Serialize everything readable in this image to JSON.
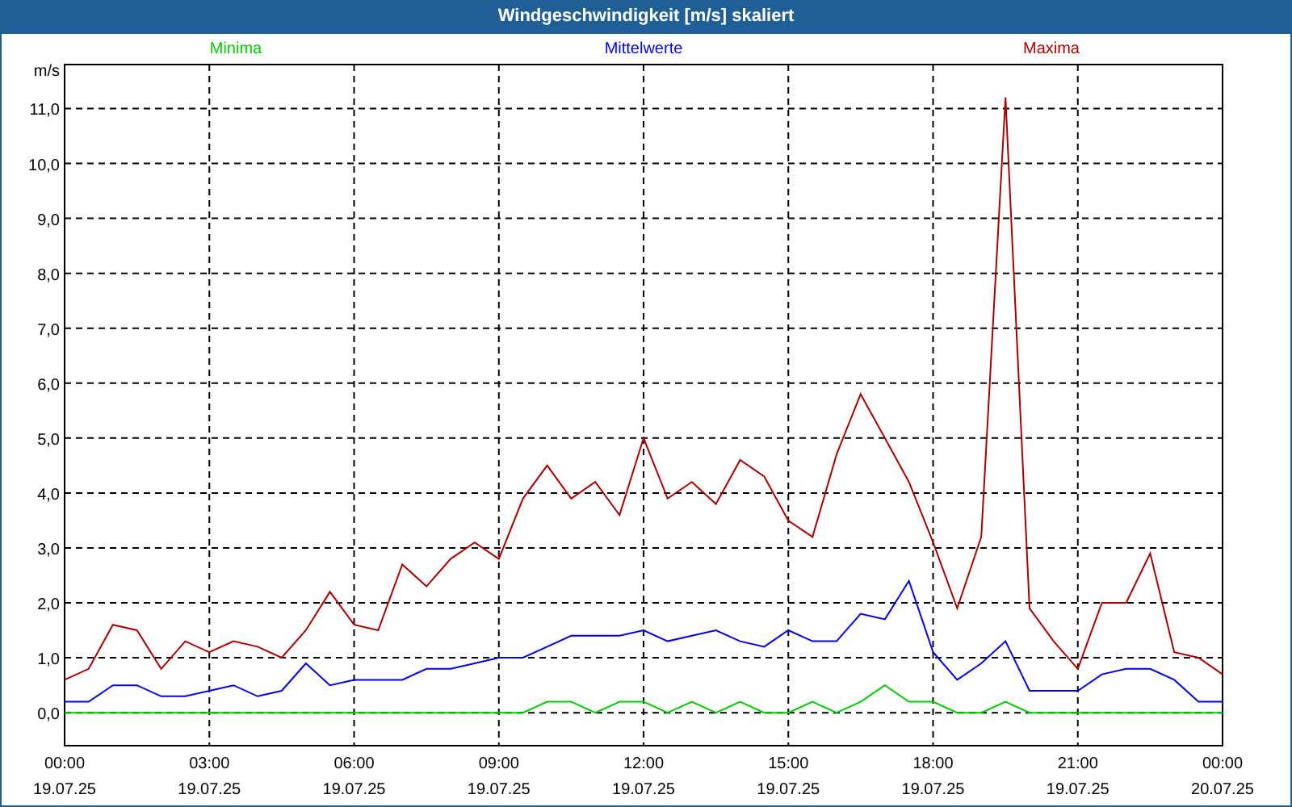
{
  "window": {
    "title": "Windgeschwindigkeit [m/s] skaliert"
  },
  "chart": {
    "chart_data": {
      "type": "line",
      "grid": true,
      "ylabel": "m/s",
      "ylim": [
        -0.6,
        11.8
      ],
      "categories": [
        "00:00\n19.07.25",
        null,
        null,
        null,
        null,
        null,
        "03:00\n19.07.25",
        null,
        null,
        null,
        null,
        null,
        "06:00\n19.07.25",
        null,
        null,
        null,
        null,
        null,
        "09:00\n19.07.25",
        null,
        null,
        null,
        null,
        null,
        "12:00\n19.07.25",
        null,
        null,
        null,
        null,
        null,
        "15:00\n19.07.25",
        null,
        null,
        null,
        null,
        null,
        "18:00\n19.07.25",
        null,
        null,
        null,
        null,
        null,
        "21:00\n19.07.25",
        null,
        null,
        null,
        null,
        null,
        "00:00\n20.07.25"
      ],
      "series": [
        {
          "name": "Minima",
          "color": "#00cc00",
          "values": [
            0,
            0,
            0,
            0,
            0,
            0,
            0,
            0,
            0,
            0,
            0,
            0,
            0,
            0,
            0,
            0,
            0,
            0,
            0,
            0,
            0.2,
            0.2,
            0,
            0.2,
            0.2,
            0,
            0.2,
            0,
            0.2,
            0,
            0,
            0.2,
            0,
            0.2,
            0.5,
            0.2,
            0.2,
            0,
            0,
            0.2,
            0,
            0,
            0,
            0,
            0,
            0,
            0,
            0,
            0
          ]
        },
        {
          "name": "Mittelwerte",
          "color": "#0000ee",
          "values": [
            0.2,
            0.2,
            0.5,
            0.5,
            0.3,
            0.3,
            0.4,
            0.5,
            0.3,
            0.4,
            0.9,
            0.5,
            0.6,
            0.6,
            0.6,
            0.8,
            0.8,
            0.9,
            1.0,
            1.0,
            1.2,
            1.4,
            1.4,
            1.4,
            1.5,
            1.3,
            1.4,
            1.5,
            1.3,
            1.2,
            1.5,
            1.3,
            1.3,
            1.8,
            1.7,
            2.4,
            1.1,
            0.6,
            0.9,
            1.3,
            0.4,
            0.4,
            0.4,
            0.7,
            0.8,
            0.8,
            0.6,
            0.2,
            0.2
          ]
        },
        {
          "name": "Maxima",
          "color": "#aa0000",
          "values": [
            0.6,
            0.8,
            1.6,
            1.5,
            0.8,
            1.3,
            1.1,
            1.3,
            1.2,
            1.0,
            1.5,
            2.2,
            1.6,
            1.5,
            2.7,
            2.3,
            2.8,
            3.1,
            2.8,
            3.9,
            4.5,
            3.9,
            4.2,
            3.6,
            5.0,
            3.9,
            4.2,
            3.8,
            4.6,
            4.3,
            3.5,
            3.2,
            4.7,
            5.8,
            5.0,
            4.2,
            3.1,
            1.9,
            3.2,
            11.2,
            1.9,
            1.3,
            0.8,
            2.0,
            2.0,
            2.9,
            1.1,
            1.0,
            0.7
          ]
        }
      ],
      "yticks": [
        {
          "value": 0,
          "label": "0,0"
        },
        {
          "value": 1,
          "label": "1,0"
        },
        {
          "value": 2,
          "label": "2,0"
        },
        {
          "value": 3,
          "label": "3,0"
        },
        {
          "value": 4,
          "label": "4,0"
        },
        {
          "value": 5,
          "label": "5,0"
        },
        {
          "value": 6,
          "label": "6,0"
        },
        {
          "value": 7,
          "label": "7,0"
        },
        {
          "value": 8,
          "label": "8,0"
        },
        {
          "value": 9,
          "label": "9,0"
        },
        {
          "value": 10,
          "label": "10,0"
        },
        {
          "value": 11,
          "label": "11,0"
        }
      ]
    }
  }
}
